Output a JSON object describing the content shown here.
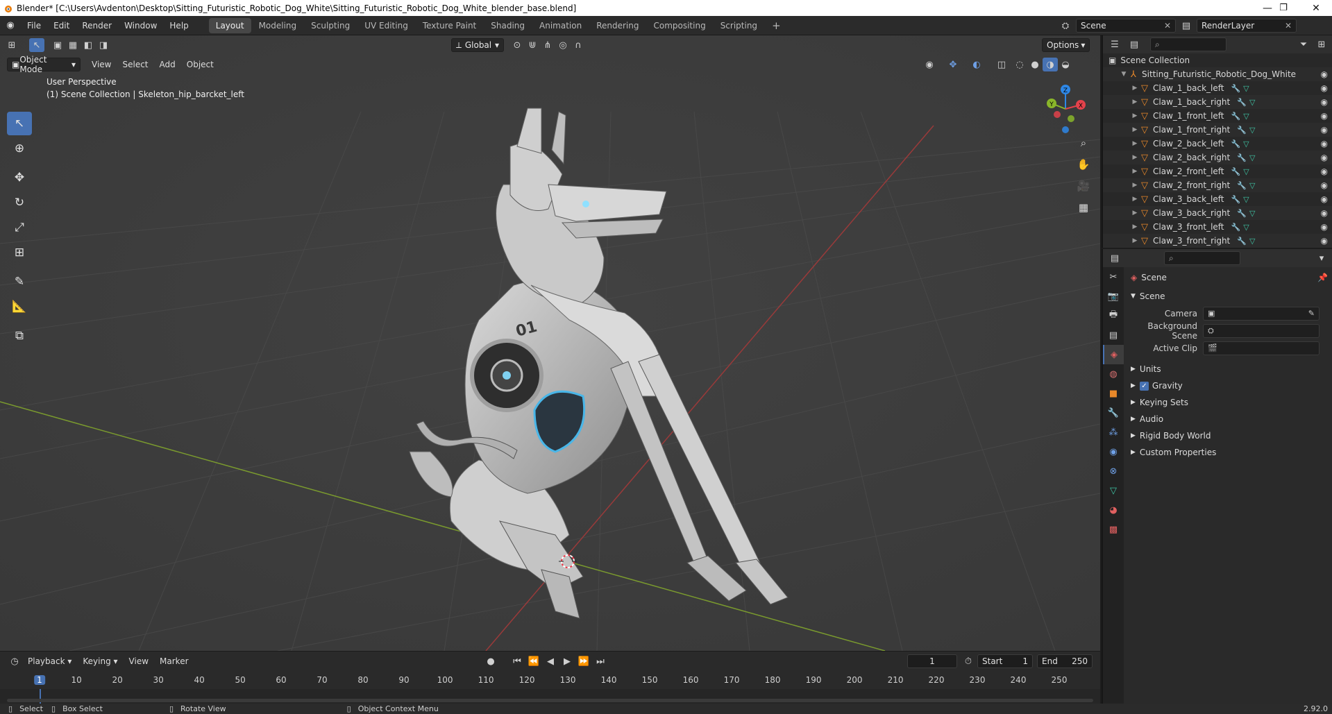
{
  "window": {
    "title": "Blender* [C:\\Users\\Avdenton\\Desktop\\Sitting_Futuristic_Robotic_Dog_White\\Sitting_Futuristic_Robotic_Dog_White_blender_base.blend]",
    "minimize_glyph": "—",
    "maximize_glyph": "❐",
    "close_glyph": "✕"
  },
  "menu": [
    "File",
    "Edit",
    "Render",
    "Window",
    "Help"
  ],
  "workspaces": [
    "Layout",
    "Modeling",
    "Sculpting",
    "UV Editing",
    "Texture Paint",
    "Shading",
    "Animation",
    "Rendering",
    "Compositing",
    "Scripting"
  ],
  "active_workspace": "Layout",
  "add_workspace_glyph": "+",
  "scene_field": "Scene",
  "view_layer_field": "RenderLayer",
  "viewport_header": {
    "transform_orientation": "Global",
    "options_label": "Options",
    "mode": "Object Mode",
    "menus": [
      "View",
      "Select",
      "Add",
      "Object"
    ]
  },
  "viewport_info": {
    "perspective": "User Perspective",
    "context": "(1) Scene Collection | Skeleton_hip_barcket_left"
  },
  "gizmo_axes": {
    "x": "X",
    "y": "Y",
    "z": "Z"
  },
  "timeline": {
    "menus": [
      "Playback",
      "Keying",
      "View",
      "Marker"
    ],
    "current_frame": "1",
    "start_label": "Start",
    "start": "1",
    "end_label": "End",
    "end": "250",
    "ticks": [
      "1",
      "10",
      "20",
      "30",
      "40",
      "50",
      "60",
      "70",
      "80",
      "90",
      "100",
      "110",
      "120",
      "130",
      "140",
      "150",
      "160",
      "170",
      "180",
      "190",
      "200",
      "210",
      "220",
      "230",
      "240",
      "250"
    ]
  },
  "statusbar": {
    "select": "Select",
    "box_select": "Box Select",
    "rotate_view": "Rotate View",
    "context_menu": "Object Context Menu",
    "version": "2.92.0"
  },
  "outliner": {
    "root": "Scene Collection",
    "collection": "Sitting_Futuristic_Robotic_Dog_White",
    "objects": [
      "Claw_1_back_left",
      "Claw_1_back_right",
      "Claw_1_front_left",
      "Claw_1_front_right",
      "Claw_2_back_left",
      "Claw_2_back_right",
      "Claw_2_front_left",
      "Claw_2_front_right",
      "Claw_3_back_left",
      "Claw_3_back_right",
      "Claw_3_front_left",
      "Claw_3_front_right"
    ]
  },
  "properties": {
    "context_title": "Scene",
    "panel_title": "Scene",
    "camera_label": "Camera",
    "background_scene_label": "Background Scene",
    "active_clip_label": "Active Clip",
    "sections": [
      "Units",
      "Gravity",
      "Keying Sets",
      "Audio",
      "Rigid Body World",
      "Custom Properties"
    ],
    "gravity_checked": true
  },
  "colors": {
    "accent": "#4772b3",
    "x_axis": "#e3424b",
    "y_axis": "#8ab62a",
    "z_axis": "#2e87e6",
    "object_icon": "#e8882a",
    "mesh_icon": "#3fc6a6"
  }
}
